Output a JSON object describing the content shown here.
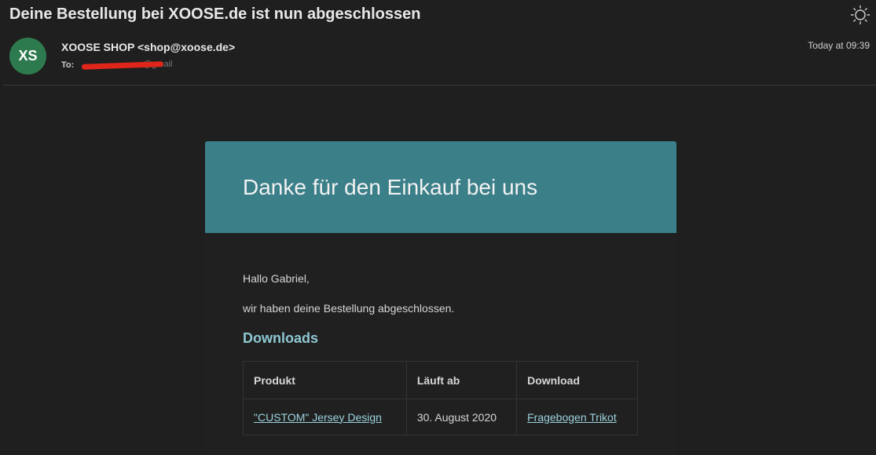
{
  "email": {
    "subject": "Deine Bestellung bei XOOSE.de ist nun abgeschlossen",
    "avatar_initials": "XS",
    "sender": "XOOSE SHOP <shop@xoose.de>",
    "to_label": "To:",
    "recipient_visible": "@gmail",
    "timestamp": "Today at 09:39"
  },
  "message": {
    "header_title": "Danke für den Einkauf bei uns",
    "greeting": "Hallo Gabriel,",
    "body": "wir haben deine Bestellung abgeschlossen.",
    "downloads_title": "Downloads",
    "table": {
      "headers": [
        "Produkt",
        "Läuft ab",
        "Download"
      ],
      "rows": [
        [
          "\"CUSTOM\" Jersey Design",
          "30. August 2020",
          "Fragebogen Trikot"
        ]
      ]
    }
  },
  "colors": {
    "header_bg": "#3b7f89",
    "avatar_bg": "#2e7a4f",
    "link": "#9cd3df",
    "redaction": "#e0261b"
  },
  "icons": {
    "theme_toggle": "sun-icon"
  }
}
